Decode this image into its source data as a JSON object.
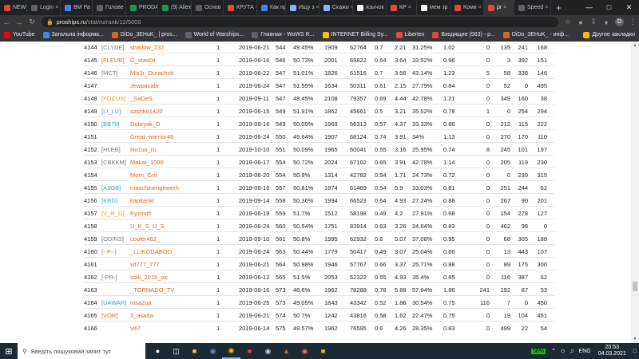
{
  "browser": {
    "tabs": [
      {
        "title": "NEW А",
        "color": "#e8453c"
      },
      {
        "title": "Login",
        "color": "#5f6368"
      },
      {
        "title": "ВМ Ра",
        "color": "#4285f4"
      },
      {
        "title": "Голове",
        "color": "#5f6368"
      },
      {
        "title": "PRODA",
        "color": "#0f9d58"
      },
      {
        "title": "(9) Aliex",
        "color": "#0f9d58"
      },
      {
        "title": "Основ",
        "color": "#5f6368"
      },
      {
        "title": "КРУТА",
        "color": "#e8453c"
      },
      {
        "title": "Как пр",
        "color": "#4285f4"
      },
      {
        "title": "Ищу з",
        "color": "#8ab4f8"
      },
      {
        "title": "Скажи",
        "color": "#8ab4f8"
      },
      {
        "title": "язычок",
        "color": "#ffffff"
      },
      {
        "title": "КР",
        "color": "#e8453c"
      },
      {
        "title": "мем зр",
        "color": "#ffffff"
      },
      {
        "title": "Коми",
        "color": "#e8453c"
      },
      {
        "title": "pr",
        "color": "#e8453c",
        "active": true
      },
      {
        "title": "Speed",
        "color": "#5f6368"
      }
    ],
    "new_tab": "+",
    "url_host": "proships.ru",
    "url_path": "/stat/ru/rank/12/5000",
    "avatar_letter": "D",
    "bookmarks": [
      {
        "label": "YouTube",
        "color": "#ff0000"
      },
      {
        "label": "Загальна інформа...",
        "color": "#4285f4"
      },
      {
        "label": "DiDo_3EHuK_ | pros...",
        "color": "#d9661c"
      },
      {
        "label": "World of Warships...",
        "color": "#5f6368"
      },
      {
        "label": "Главная - WoWS R...",
        "color": "#5f6368"
      },
      {
        "label": "INTERNET Billing Sy...",
        "color": "#fbbc05"
      },
      {
        "label": "Libertex",
        "color": "#e8453c"
      },
      {
        "label": "Входящие (563) - p...",
        "color": "#e8453c"
      },
      {
        "label": "DiDo_3EHuK_ - инф...",
        "color": "#d9661c"
      }
    ],
    "other_bookmarks": "Другие закладки"
  },
  "table": {
    "rows": [
      {
        "rank": "4144",
        "clan": "[CLYDE]",
        "clan_color": "#777777",
        "name": "shadow_237",
        "one": "1",
        "date": "2019-06-21",
        "n": "544",
        "wr": "49.45%",
        "battles": "1909",
        "dmg": "62764",
        "kd": "0.7",
        "frags": "2.21",
        "surv": "31.25%",
        "k2": "1.02",
        "z": "0",
        "a": "135",
        "b": "241",
        "c": "168"
      },
      {
        "rank": "4145",
        "clan": "[FLEUR]",
        "clan_color": "#d9661c",
        "name": "G_stas04",
        "one": "1",
        "date": "2019-06-16",
        "n": "546",
        "wr": "50.73%",
        "battles": "2001",
        "dmg": "69822",
        "kd": "0.64",
        "frags": "3.64",
        "surv": "33.52%",
        "k2": "0.96",
        "z": "0",
        "a": "3",
        "b": "392",
        "c": "151"
      },
      {
        "rank": "4146",
        "clan": "[MCT]",
        "clan_color": "#777777",
        "name": "Mix3r_Durachok",
        "one": "1",
        "date": "2019-06-22",
        "n": "547",
        "wr": "51.01%",
        "battles": "1826",
        "dmg": "61516",
        "kd": "0.7",
        "frags": "3.56",
        "surv": "43.14%",
        "k2": "1.23",
        "z": "5",
        "a": "58",
        "b": "338",
        "c": "146"
      },
      {
        "rank": "4147",
        "clan": "",
        "clan_color": "#777777",
        "name": "Jewpacabr",
        "one": "1",
        "date": "2019-06-24",
        "n": "547",
        "wr": "51.55%",
        "battles": "1634",
        "dmg": "50311",
        "kd": "0.61",
        "frags": "2.15",
        "surv": "27.79%",
        "k2": "0.84",
        "z": "0",
        "a": "52",
        "b": "0",
        "c": "495"
      },
      {
        "rank": "4148",
        "clan": "[FOCUS]",
        "clan_color": "#e8a317",
        "name": "_SaDeS",
        "one": "1",
        "date": "2019-09-11",
        "n": "547",
        "wr": "48.45%",
        "battles": "2108",
        "dmg": "79357",
        "kd": "0.69",
        "frags": "4.44",
        "surv": "42.78%",
        "k2": "1.21",
        "z": "0",
        "a": "349",
        "b": "160",
        "c": "38"
      },
      {
        "rank": "4149",
        "clan": "[LI_LU]",
        "clan_color": "#3aa0c8",
        "name": "sashko1420",
        "one": "1",
        "date": "2019-06-15",
        "n": "549",
        "wr": "51.91%",
        "battles": "1862",
        "dmg": "45661",
        "kd": "0.5",
        "frags": "3.21",
        "surv": "35.52%",
        "k2": "0.78",
        "z": "1",
        "a": "0",
        "b": "254",
        "c": "294"
      },
      {
        "rank": "4150",
        "clan": "[BB78]",
        "clan_color": "#3aa0c8",
        "name": "Dobryak_D",
        "one": "1",
        "date": "2019-06-16",
        "n": "549",
        "wr": "50.09%",
        "battles": "1969",
        "dmg": "56313",
        "kd": "0.57",
        "frags": "4.37",
        "surv": "33.33%",
        "k2": "0.86",
        "z": "0",
        "a": "212",
        "b": "115",
        "c": "222"
      },
      {
        "rank": "4151",
        "clan": "",
        "clan_color": "#777777",
        "name": "Great_warrior48",
        "one": "1",
        "date": "2019-06-24",
        "n": "550",
        "wr": "49.64%",
        "battles": "1907",
        "dmg": "68124",
        "kd": "0.74",
        "frags": "3.91",
        "surv": "34%",
        "k2": "1.13",
        "z": "0",
        "a": "270",
        "b": "170",
        "c": "110"
      },
      {
        "rank": "4152",
        "clan": "[HLEB]",
        "clan_color": "#777777",
        "name": "No1sa_ru",
        "one": "1",
        "date": "2019-10-10",
        "n": "551",
        "wr": "50.09%",
        "battles": "1965",
        "dmg": "60041",
        "kd": "0.55",
        "frags": "3.16",
        "surv": "25.95%",
        "k2": "0.74",
        "z": "8",
        "a": "245",
        "b": "101",
        "c": "197"
      },
      {
        "rank": "4153",
        "clan": "[CBKKM]",
        "clan_color": "#777777",
        "name": "Makar_1000",
        "one": "1",
        "date": "2019-06-17",
        "n": "554",
        "wr": "50.72%",
        "battles": "2024",
        "dmg": "67102",
        "kd": "0.65",
        "frags": "3.91",
        "surv": "42.78%",
        "k2": "1.14",
        "z": "0",
        "a": "205",
        "b": "119",
        "c": "230"
      },
      {
        "rank": "4154",
        "clan": "",
        "clan_color": "#777777",
        "name": "Morn_Grif",
        "one": "1",
        "date": "2019-06-20",
        "n": "554",
        "wr": "50.9%",
        "battles": "1314",
        "dmg": "42782",
        "kd": "0.54",
        "frags": "1.71",
        "surv": "24.73%",
        "k2": "0.72",
        "z": "0",
        "a": "0",
        "b": "239",
        "c": "315"
      },
      {
        "rank": "4155",
        "clan": "[A3OB]",
        "clan_color": "#3aa0c8",
        "name": "maschinengewerh",
        "one": "1",
        "date": "2019-06-16",
        "n": "557",
        "wr": "50.81%",
        "battles": "1974",
        "dmg": "61489",
        "kd": "0.54",
        "frags": "5.9",
        "surv": "33.03%",
        "k2": "0.81",
        "z": "0",
        "a": "251",
        "b": "244",
        "c": "62"
      },
      {
        "rank": "4156",
        "clan": "[KRD]",
        "clan_color": "#3aa0c8",
        "name": "kapitankr",
        "one": "1",
        "date": "2019-09-14",
        "n": "558",
        "wr": "50.36%",
        "battles": "1994",
        "dmg": "66523",
        "kd": "0.64",
        "frags": "4.93",
        "surv": "27.24%",
        "k2": "0.88",
        "z": "0",
        "a": "267",
        "b": "90",
        "c": "201"
      },
      {
        "rank": "4157",
        "clan": "[V_R_G]",
        "clan_color": "#e8a317",
        "name": "Kyzmith",
        "one": "1",
        "date": "2019-06-19",
        "n": "559",
        "wr": "51.7%",
        "battles": "1512",
        "dmg": "58198",
        "kd": "0.49",
        "frags": "4.2",
        "surv": "27.91%",
        "k2": "0.68",
        "z": "0",
        "a": "154",
        "b": "278",
        "c": "127"
      },
      {
        "rank": "4158",
        "clan": "",
        "clan_color": "#777777",
        "name": "U_K_S_U_S",
        "one": "1",
        "date": "2019-06-24",
        "n": "560",
        "wr": "50.54%",
        "battles": "1751",
        "dmg": "83914",
        "kd": "0.63",
        "frags": "3.26",
        "surv": "24.64%",
        "k2": "0.83",
        "z": "0",
        "a": "462",
        "b": "98",
        "c": "0"
      },
      {
        "rank": "4159",
        "clan": "[ODINS]",
        "clan_color": "#777777",
        "name": "cooler462_",
        "one": "1",
        "date": "2019-09-10",
        "n": "561",
        "wr": "50.8%",
        "battles": "1995",
        "dmg": "62932",
        "kd": "0.6",
        "frags": "5.07",
        "surv": "37.08%",
        "k2": "0.95",
        "z": "0",
        "a": "68",
        "b": "305",
        "c": "188"
      },
      {
        "rank": "4160",
        "clan": "[--F--]",
        "clan_color": "#d9661c",
        "name": "_LLIKODABOD_",
        "one": "1",
        "date": "2019-06-24",
        "n": "563",
        "wr": "50.44%",
        "battles": "1779",
        "dmg": "50417",
        "kd": "0.49",
        "frags": "3.07",
        "surv": "25.04%",
        "k2": "0.66",
        "z": "0",
        "a": "13",
        "b": "443",
        "c": "107"
      },
      {
        "rank": "4161",
        "clan": "",
        "clan_color": "#777777",
        "name": "vit777_777",
        "one": "1",
        "date": "2019-06-21",
        "n": "564",
        "wr": "50.98%",
        "battles": "1946",
        "dmg": "57767",
        "kd": "0.66",
        "frags": "3.37",
        "surv": "25.71%",
        "k2": "0.88",
        "z": "0",
        "a": "89",
        "b": "175",
        "c": "300"
      },
      {
        "rank": "4162",
        "clan": "[-PR-]",
        "clan_color": "#777777",
        "name": "volk_2015_vic",
        "one": "1",
        "date": "2019-06-12",
        "n": "565",
        "wr": "51.5%",
        "battles": "2053",
        "dmg": "62322",
        "kd": "0.55",
        "frags": "4.93",
        "surv": "35.4%",
        "k2": "0.85",
        "z": "0",
        "a": "116",
        "b": "387",
        "c": "62"
      },
      {
        "rank": "4163",
        "clan": "",
        "clan_color": "#777777",
        "name": "_TORNADO_TV",
        "one": "1",
        "date": "2019-06-16",
        "n": "573",
        "wr": "46.6%",
        "battles": "1962",
        "dmg": "78288",
        "kd": "0.78",
        "frags": "5.88",
        "surv": "57.94%",
        "k2": "1.86",
        "z": "241",
        "a": "192",
        "b": "87",
        "c": "53"
      },
      {
        "rank": "4164",
        "clan": "[UAWAR]",
        "clan_color": "#3aa0c8",
        "name": "msa2ua",
        "one": "1",
        "date": "2019-06-25",
        "n": "573",
        "wr": "49.05%",
        "battles": "1843",
        "dmg": "43342",
        "kd": "0.52",
        "frags": "1.86",
        "surv": "30.54%",
        "k2": "0.75",
        "z": "116",
        "a": "7",
        "b": "0",
        "c": "450"
      },
      {
        "rank": "4165",
        "clan": "[VOR]",
        "clan_color": "#d9661c",
        "name": "3_asada",
        "one": "1",
        "date": "2019-06-21",
        "n": "574",
        "wr": "50.7%",
        "battles": "1242",
        "dmg": "43816",
        "kd": "0.58",
        "frags": "1.62",
        "surv": "22.47%",
        "k2": "0.75",
        "z": "0",
        "a": "19",
        "b": "104",
        "c": "451"
      },
      {
        "rank": "4166",
        "clan": "",
        "clan_color": "#777777",
        "name": "vili7",
        "one": "1",
        "date": "2019-06-14",
        "n": "575",
        "wr": "49.57%",
        "battles": "1962",
        "dmg": "76595",
        "kd": "0.6",
        "frags": "4.26",
        "surv": "28.35%",
        "k2": "0.83",
        "z": "0",
        "a": "499",
        "b": "22",
        "c": "54"
      }
    ]
  },
  "taskbar": {
    "search_placeholder": "Введіть пошуковий запит тут",
    "battery": "58%",
    "language": "ENG",
    "time": "20:53",
    "date": "04.03.2021"
  }
}
